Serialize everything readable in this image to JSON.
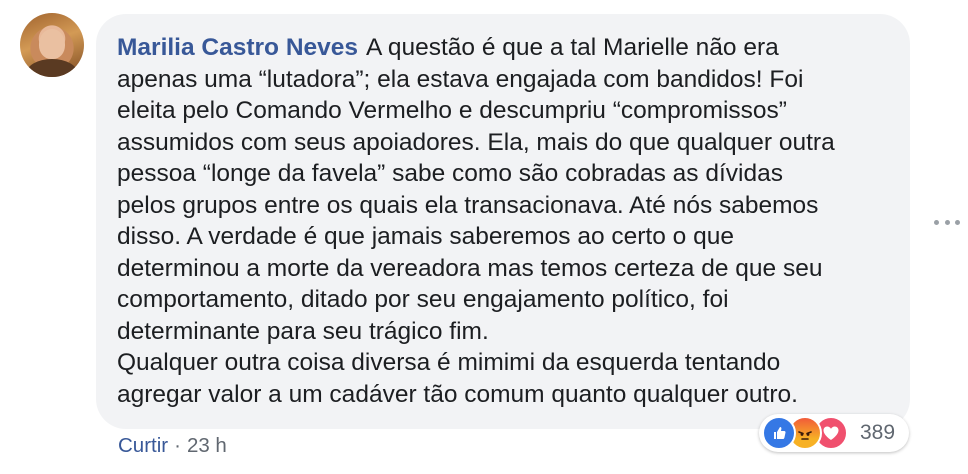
{
  "comment": {
    "author": "Marilia Castro Neves",
    "lines": [
      "A questão é que a tal Marielle não era",
      "apenas uma “lutadora”; ela estava engajada com bandidos! Foi",
      "eleita pelo Comando Vermelho e descumpriu “compromissos”",
      "assumidos com seus apoiadores. Ela, mais do que qualquer outra",
      "pessoa “longe da favela” sabe como são cobradas as dívidas",
      "pelos grupos entre os quais ela transacionava. Até nós sabemos",
      "disso. A verdade é que jamais saberemos ao certo o que",
      "determinou a morte da vereadora mas temos certeza de que seu",
      "comportamento, ditado por seu engajamento político, foi",
      "determinante para seu trágico fim.",
      "Qualquer outra coisa diversa é mimimi da esquerda tentando",
      "agregar valor a um cadáver tão comum quanto qualquer outro."
    ]
  },
  "actions": {
    "like_label": "Curtir",
    "separator": "·",
    "timestamp": "23 h"
  },
  "reactions": {
    "types": [
      "like",
      "angry",
      "love"
    ],
    "count": "389"
  },
  "icons": {
    "more": "more-horizontal-icon"
  }
}
